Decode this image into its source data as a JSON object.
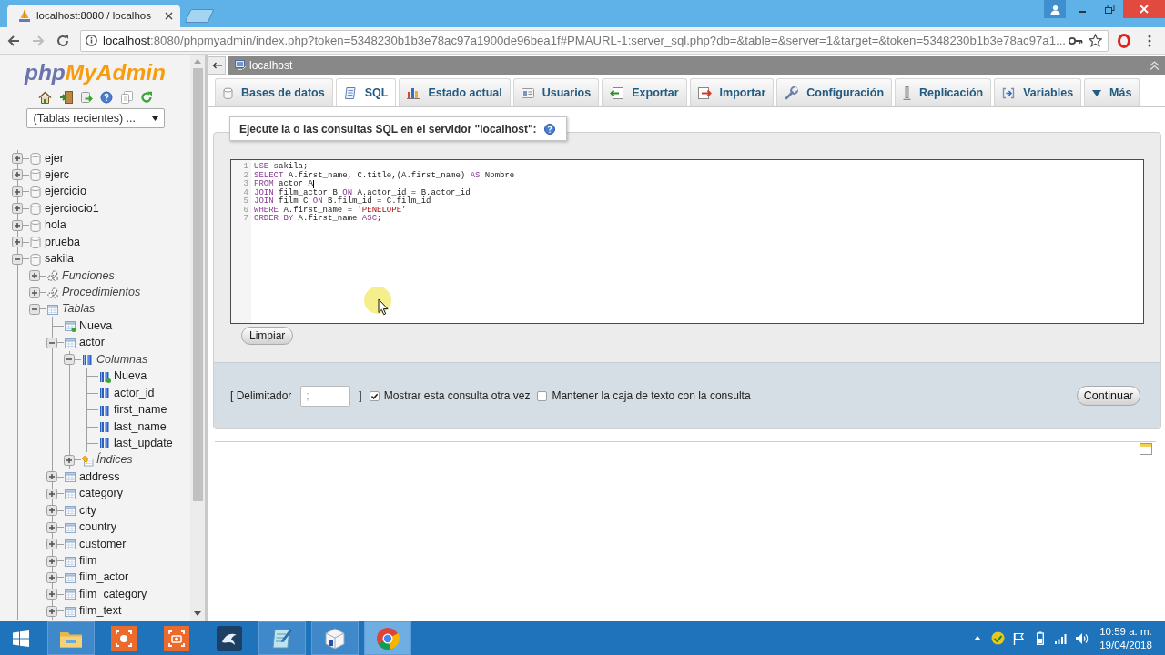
{
  "browser": {
    "tabs": [
      {
        "title": "localhost:8080 / localhos",
        "selected": true
      }
    ],
    "nav_buttons": [
      {
        "kind": "back",
        "disabled": false
      },
      {
        "kind": "forward",
        "disabled": true
      },
      {
        "kind": "reload",
        "disabled": false
      }
    ],
    "url": {
      "host": "localhost",
      "rest": ":8080/phpmyadmin/index.php?token=5348230b1b3e78ac97a1900de96bea1f#PMAURL-1:server_sql.php?db=&table=&server=1&target=&token=5348230b1b3e78ac97a1..."
    }
  },
  "sidebar": {
    "logo": {
      "first": "php",
      "second": "MyAdmin"
    },
    "recent_tables": {
      "value": "(Tablas recientes) ..."
    },
    "tree": [
      {
        "label": "ejer",
        "kind": "database",
        "expanded": false
      },
      {
        "label": "ejerc",
        "kind": "database",
        "expanded": false
      },
      {
        "label": "ejercicio",
        "kind": "database",
        "expanded": false
      },
      {
        "label": "ejerciocio1",
        "kind": "database",
        "expanded": false
      },
      {
        "label": "hola",
        "kind": "database",
        "expanded": false
      },
      {
        "label": "prueba",
        "kind": "database",
        "expanded": false
      },
      {
        "label": "sakila",
        "kind": "database",
        "expanded": true,
        "children": [
          {
            "label": "Funciones",
            "kind": "routines",
            "expanded": false
          },
          {
            "label": "Procedimientos",
            "kind": "routines",
            "expanded": false
          },
          {
            "label": "Tablas",
            "kind": "tables",
            "expanded": true,
            "children": [
              {
                "label": "Nueva",
                "kind": "new_table"
              },
              {
                "label": "actor",
                "kind": "table",
                "expanded": true,
                "children": [
                  {
                    "label": "Columnas",
                    "kind": "columns",
                    "expanded": true,
                    "children": [
                      {
                        "label": "Nueva",
                        "kind": "new_column"
                      },
                      {
                        "label": "actor_id",
                        "kind": "column"
                      },
                      {
                        "label": "first_name",
                        "kind": "column"
                      },
                      {
                        "label": "last_name",
                        "kind": "column"
                      },
                      {
                        "label": "last_update",
                        "kind": "column"
                      }
                    ]
                  },
                  {
                    "label": "Índices",
                    "kind": "indexes",
                    "expanded": false
                  }
                ]
              },
              {
                "label": "address",
                "kind": "table",
                "expanded": false
              },
              {
                "label": "category",
                "kind": "table",
                "expanded": false
              },
              {
                "label": "city",
                "kind": "table",
                "expanded": false
              },
              {
                "label": "country",
                "kind": "table",
                "expanded": false
              },
              {
                "label": "customer",
                "kind": "table",
                "expanded": false
              },
              {
                "label": "film",
                "kind": "table",
                "expanded": false
              },
              {
                "label": "film_actor",
                "kind": "table",
                "expanded": false
              },
              {
                "label": "film_category",
                "kind": "table",
                "expanded": false
              },
              {
                "label": "film_text",
                "kind": "table",
                "expanded": false
              }
            ]
          }
        ]
      }
    ]
  },
  "server_bar": {
    "title": "localhost"
  },
  "tabs": [
    {
      "label": "Bases de datos",
      "kind": "databases",
      "selected": false
    },
    {
      "label": "SQL",
      "kind": "sql",
      "selected": true
    },
    {
      "label": "Estado actual",
      "kind": "status",
      "selected": false
    },
    {
      "label": "Usuarios",
      "kind": "users",
      "selected": false
    },
    {
      "label": "Exportar",
      "kind": "export",
      "selected": false
    },
    {
      "label": "Importar",
      "kind": "import",
      "selected": false
    },
    {
      "label": "Configuración",
      "kind": "settings",
      "selected": false
    },
    {
      "label": "Replicación",
      "kind": "replication",
      "selected": false
    },
    {
      "label": "Variables",
      "kind": "variables",
      "selected": false
    },
    {
      "label": "Más",
      "kind": "more",
      "selected": false
    }
  ],
  "query_panel": {
    "legend": "Ejecute la o las consultas SQL en el servidor \"localhost\":",
    "editor": {
      "lines": [
        {
          "number": "1",
          "caret": false,
          "tokens": [
            {
              "kind": "keyword",
              "text": "USE"
            },
            {
              "kind": "plain",
              "text": " sakila;"
            }
          ]
        },
        {
          "number": "2",
          "caret": false,
          "tokens": [
            {
              "kind": "keyword",
              "text": "SELECT"
            },
            {
              "kind": "plain",
              "text": " A.first_name, C.title,(A.first_name) "
            },
            {
              "kind": "keyword",
              "text": "AS"
            },
            {
              "kind": "plain",
              "text": " Nombre"
            }
          ]
        },
        {
          "number": "3",
          "caret": true,
          "tokens": [
            {
              "kind": "keyword",
              "text": "FROM"
            },
            {
              "kind": "plain",
              "text": " actor A"
            }
          ]
        },
        {
          "number": "4",
          "caret": false,
          "tokens": [
            {
              "kind": "keyword",
              "text": "JOIN"
            },
            {
              "kind": "plain",
              "text": " film_actor B "
            },
            {
              "kind": "keyword",
              "text": "ON"
            },
            {
              "kind": "plain",
              "text": " A.actor_id = B.actor_id"
            }
          ]
        },
        {
          "number": "5",
          "caret": false,
          "tokens": [
            {
              "kind": "keyword",
              "text": "JOIN"
            },
            {
              "kind": "plain",
              "text": " film C "
            },
            {
              "kind": "keyword",
              "text": "ON"
            },
            {
              "kind": "plain",
              "text": " B.film_id = C.film_id"
            }
          ]
        },
        {
          "number": "6",
          "caret": false,
          "tokens": [
            {
              "kind": "keyword",
              "text": "WHERE"
            },
            {
              "kind": "plain",
              "text": " A.first_name = "
            },
            {
              "kind": "string",
              "text": "'PENELOPE'"
            }
          ]
        },
        {
          "number": "7",
          "caret": false,
          "tokens": [
            {
              "kind": "keyword",
              "text": "ORDER BY"
            },
            {
              "kind": "plain",
              "text": " A.first_name "
            },
            {
              "kind": "keyword",
              "text": "ASC"
            },
            {
              "kind": "plain",
              "text": ";"
            }
          ]
        }
      ]
    },
    "clear_button": "Limpiar",
    "delimiter_open": "[ Delimitador",
    "delimiter": {
      "value": ";"
    },
    "delimiter_close": "]",
    "options": [
      {
        "label": "Mostrar esta consulta otra vez",
        "checked": true
      },
      {
        "label": "Mantener la caja de texto con la consulta",
        "checked": false
      }
    ],
    "submit_button": "Continuar"
  },
  "taskbar": {
    "apps": [
      {
        "kind": "files",
        "running": true,
        "selected": false
      },
      {
        "kind": "recorder",
        "running": false,
        "selected": false
      },
      {
        "kind": "camera",
        "running": false,
        "selected": false
      },
      {
        "kind": "dolphin",
        "running": false,
        "selected": false
      },
      {
        "kind": "notepad",
        "running": true,
        "selected": false
      },
      {
        "kind": "cube",
        "running": true,
        "selected": false
      },
      {
        "kind": "browser",
        "running": true,
        "selected": true
      }
    ],
    "clock": {
      "time": "10:59 a. m.",
      "date": "19/04/2018"
    }
  }
}
